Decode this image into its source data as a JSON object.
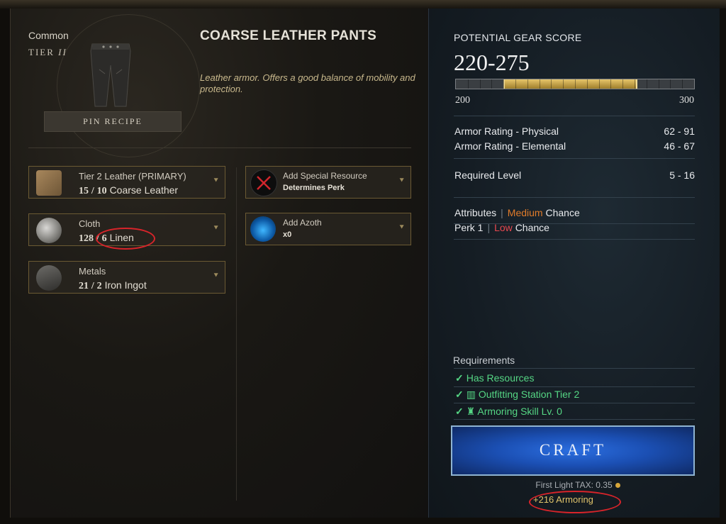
{
  "item": {
    "rarity": "Common",
    "tier_word": "TIER",
    "tier_num": "II",
    "name": "COARSE LEATHER PANTS",
    "description": "Leather armor. Offers a good balance of mobility and protection.",
    "pin_recipe": "PIN RECIPE"
  },
  "ingredients": [
    {
      "name": "Tier 2 Leather (PRIMARY)",
      "have": "15",
      "need": "10",
      "resource": "Coarse Leather",
      "icon": "leather-icon"
    },
    {
      "name": "Cloth",
      "have": "128",
      "need": "6",
      "resource": "Linen",
      "icon": "cloth-icon"
    },
    {
      "name": "Metals",
      "have": "21",
      "need": "2",
      "resource": "Iron Ingot",
      "icon": "metal-ingot-icon"
    }
  ],
  "amount_sep": "/",
  "special": {
    "title": "Add Special Resource",
    "sub": "Determines Perk",
    "icon": "x-mark-icon"
  },
  "azoth": {
    "title": "Add Azoth",
    "sub": "x0",
    "icon": "azoth-flask-icon"
  },
  "gear_score": {
    "label": "POTENTIAL GEAR SCORE",
    "range": "220-275",
    "min": "200",
    "max": "300",
    "low_value": 220,
    "high_value": 275
  },
  "stats": [
    {
      "label": "Armor Rating - Physical",
      "value": "62 - 91"
    },
    {
      "label": "Armor Rating - Elemental",
      "value": "46 - 67"
    }
  ],
  "required_level": {
    "label": "Required Level",
    "value": "5 - 16"
  },
  "chances": {
    "attributes_label": "Attributes",
    "attributes_level": "Medium",
    "perk_label": "Perk 1",
    "perk_level": "Low",
    "chance_word": "Chance",
    "colors": {
      "medium": "#e07b2a",
      "low": "#e8484f"
    }
  },
  "requirements": {
    "title": "Requirements",
    "check": "✓",
    "items": [
      "Has Resources",
      "Outfitting Station Tier 2",
      "Armoring Skill Lv. 0"
    ]
  },
  "craft_button": "CRAFT",
  "tax": "First Light TAX: 0.35",
  "xp_gain": "+216 Armoring"
}
